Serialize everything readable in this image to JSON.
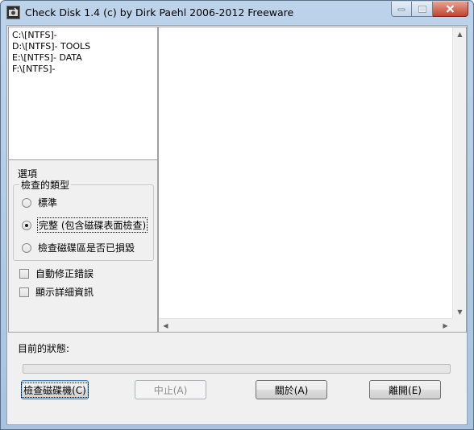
{
  "window": {
    "title": "Check Disk 1.4  (c) by Dirk Paehl  2006-2012 Freeware",
    "icon": "disk-check-app-icon"
  },
  "drives": [
    {
      "label": "C:\\[NTFS]-"
    },
    {
      "label": "D:\\[NTFS]- TOOLS"
    },
    {
      "label": "E:\\[NTFS]- DATA"
    },
    {
      "label": "F:\\[NTFS]-"
    }
  ],
  "options": {
    "title": "選項",
    "check_type_label": "檢查的類型",
    "radios": [
      {
        "label": "標準",
        "checked": false
      },
      {
        "label": "完整 (包含磁碟表面檢查)",
        "checked": true
      },
      {
        "label": "檢查磁碟區是否已損毀",
        "checked": false
      }
    ],
    "checkboxes": [
      {
        "label": "自動修正錯誤",
        "checked": false
      },
      {
        "label": "顯示詳細資訊",
        "checked": false
      }
    ]
  },
  "status": {
    "label": "目前的狀態:",
    "progress": 0
  },
  "buttons": {
    "check_disk": "檢查磁碟機(C)",
    "stop": "中止(A)",
    "about": "關於(A)",
    "close": "離開(E)"
  },
  "colors": {
    "progress_fill": "#06b025",
    "title_bar": "#bcd3ea",
    "close_button": "#c2432c"
  }
}
